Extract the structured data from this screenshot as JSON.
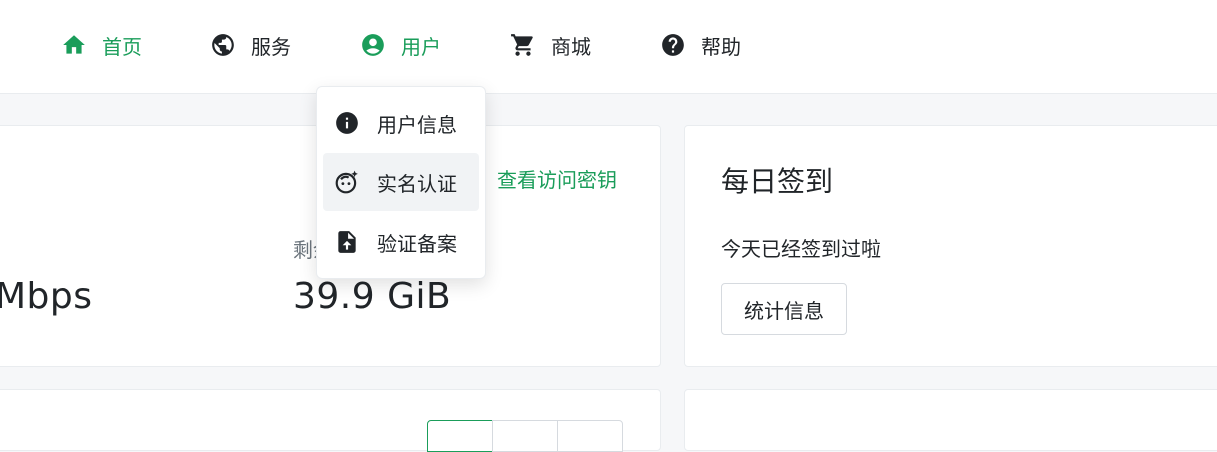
{
  "nav": {
    "items": [
      {
        "label": "首页",
        "icon": "home-icon"
      },
      {
        "label": "服务",
        "icon": "globe-icon"
      },
      {
        "label": "用户",
        "icon": "user-circle-icon"
      },
      {
        "label": "商城",
        "icon": "cart-icon"
      },
      {
        "label": "帮助",
        "icon": "help-icon"
      }
    ]
  },
  "user_menu": {
    "items": [
      {
        "label": "用户信息",
        "icon": "info-icon"
      },
      {
        "label": "实名认证",
        "icon": "face-verify-icon"
      },
      {
        "label": "验证备案",
        "icon": "file-upload-icon"
      }
    ]
  },
  "traffic_card": {
    "access_key_link": "查看访问密钥",
    "remaining_label_partial": "剩余",
    "speed_value_partial": "Mbps",
    "remaining_value": "39.9 GiB"
  },
  "checkin_card": {
    "title": "每日签到",
    "status": "今天已经签到过啦",
    "stats_button": "统计信息"
  },
  "colors": {
    "accent": "#1a9d5a",
    "text": "#212529",
    "muted": "#6c757d",
    "page_bg": "#f6f7f9"
  }
}
